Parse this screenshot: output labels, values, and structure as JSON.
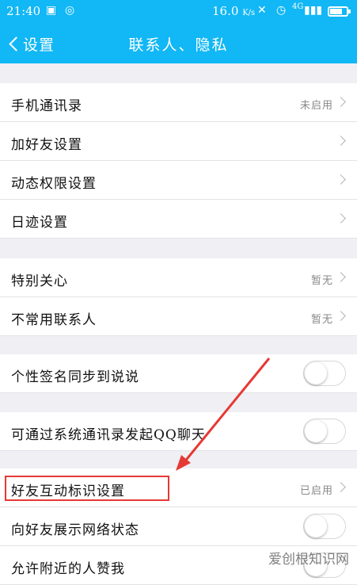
{
  "status_bar": {
    "time": "21:40",
    "speed": "16.0",
    "speed_unit": "K/s",
    "signal_text": "4G"
  },
  "nav": {
    "back_label": "设置",
    "title": "联系人、隐私"
  },
  "groups": [
    {
      "rows": [
        {
          "label": "手机通讯录",
          "value": "未启用",
          "type": "link"
        },
        {
          "label": "加好友设置",
          "value": "",
          "type": "link"
        },
        {
          "label": "动态权限设置",
          "value": "",
          "type": "link"
        },
        {
          "label": "日迹设置",
          "value": "",
          "type": "link"
        }
      ]
    },
    {
      "rows": [
        {
          "label": "特别关心",
          "value": "暂无",
          "type": "link"
        },
        {
          "label": "不常用联系人",
          "value": "暂无",
          "type": "link"
        }
      ]
    },
    {
      "rows": [
        {
          "label": "个性签名同步到说说",
          "type": "toggle",
          "on": false
        }
      ]
    },
    {
      "rows": [
        {
          "label": "可通过系统通讯录发起QQ聊天",
          "type": "toggle",
          "on": false
        }
      ]
    },
    {
      "rows": [
        {
          "label": "好友互动标识设置",
          "value": "已启用",
          "type": "link",
          "highlighted": true
        },
        {
          "label": "向好友展示网络状态",
          "type": "toggle",
          "on": false
        },
        {
          "label": "允许附近的人赞我",
          "type": "toggle",
          "on": false
        }
      ]
    }
  ],
  "watermark": "爱创根知识网",
  "colors": {
    "accent": "#12b7f5",
    "highlight": "#e53935"
  }
}
